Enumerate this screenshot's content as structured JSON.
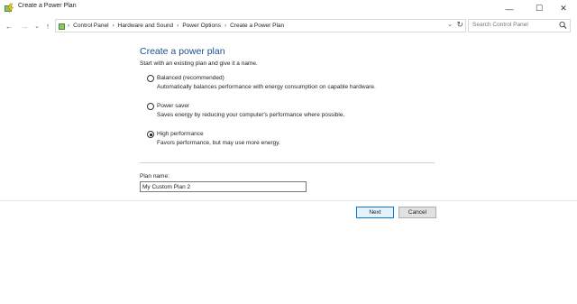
{
  "window": {
    "title": "Create a Power Plan",
    "controls": [
      "—",
      "☐",
      "✕"
    ]
  },
  "nav": {
    "back": "←",
    "forward": "→",
    "recent": "⌄",
    "up": "↑"
  },
  "address": {
    "crumbs": [
      "Control Panel",
      "Hardware and Sound",
      "Power Options",
      "Create a Power Plan"
    ],
    "separator": "›",
    "dropdown": "⌄",
    "refresh": "↻"
  },
  "search": {
    "placeholder": "Search Control Panel"
  },
  "main": {
    "title": "Create a power plan",
    "subtitle": "Start with an existing plan and give it a name.",
    "options": [
      {
        "label": "Balanced (recommended)",
        "description": "Automatically balances performance with energy consumption on capable hardware.",
        "checked": false
      },
      {
        "label": "Power saver",
        "description": "Saves energy by reducing your computer's performance where possible.",
        "checked": false
      },
      {
        "label": "High performance",
        "description": "Favors performance, but may use more energy.",
        "checked": true
      }
    ],
    "plan_name_label": "Plan name:",
    "plan_name_value": "My Custom Plan 2"
  },
  "buttons": {
    "next": "Next",
    "cancel": "Cancel"
  },
  "colors": {
    "title": "#1f4e8f",
    "accent": "#0078d7"
  }
}
